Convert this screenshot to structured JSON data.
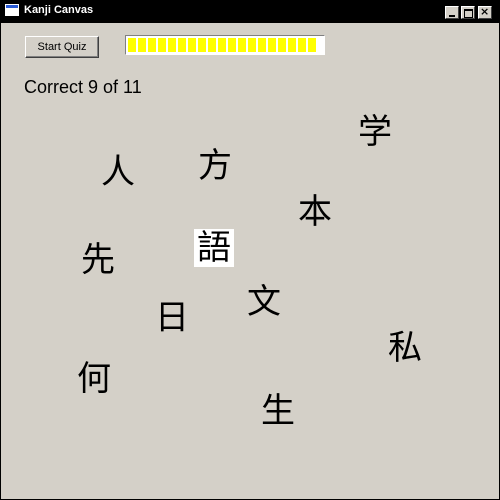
{
  "window": {
    "title": "Kanji Canvas"
  },
  "controls": {
    "start_label": "Start Quiz",
    "progress": 1.0
  },
  "score": {
    "text": "Correct 9 of 11"
  },
  "kanji": [
    {
      "char": "学",
      "name": "kanji-manabu"
    },
    {
      "char": "人",
      "name": "kanji-hito"
    },
    {
      "char": "方",
      "name": "kanji-kata"
    },
    {
      "char": "本",
      "name": "kanji-hon"
    },
    {
      "char": "先",
      "name": "kanji-saki"
    },
    {
      "char": "語",
      "name": "kanji-go",
      "selected": true
    },
    {
      "char": "文",
      "name": "kanji-bun"
    },
    {
      "char": "日",
      "name": "kanji-hi"
    },
    {
      "char": "私",
      "name": "kanji-watashi"
    },
    {
      "char": "何",
      "name": "kanji-nani"
    },
    {
      "char": "生",
      "name": "kanji-sei"
    }
  ],
  "colors": {
    "titlebar": "#000000",
    "progress": "#ffff00",
    "background": "#d4d0c8"
  }
}
